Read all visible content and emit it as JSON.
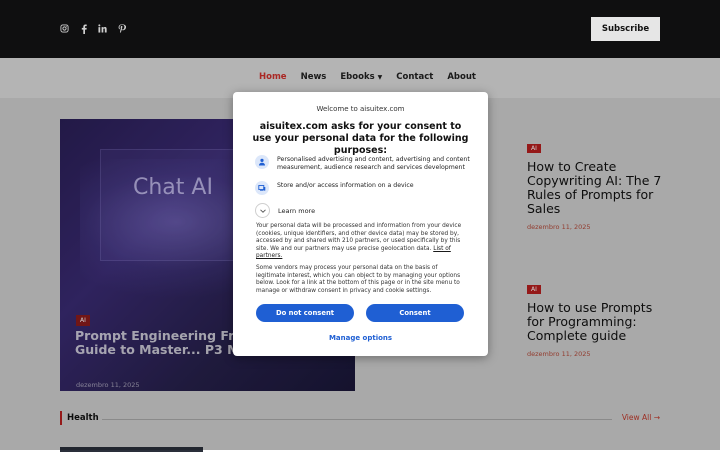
{
  "header": {
    "socials": [
      {
        "icon": "instagram-icon"
      },
      {
        "icon": "facebook-icon"
      },
      {
        "icon": "linkedin-icon"
      },
      {
        "icon": "pinterest-icon"
      }
    ],
    "subscribe_label": "Subscribe"
  },
  "nav": {
    "items": [
      {
        "label": "Home",
        "active": true
      },
      {
        "label": "News"
      },
      {
        "label": "Ebooks"
      },
      {
        "label": "Contact"
      },
      {
        "label": "About"
      }
    ]
  },
  "featured": {
    "image_text": "Chat AI",
    "category": "AI",
    "title": "Prompt Engineering From... Definitive Guide to Master... P3 Method)",
    "date": "dezembro 11, 2025"
  },
  "posts": [
    {
      "category": "AI",
      "title": "How to Create Copywriting AI: The 7 Rules of Prompts for Sales",
      "date": "dezembro 11, 2025"
    },
    {
      "category": "AI",
      "title": "How to use Prompts for Programming: Complete guide",
      "date": "dezembro 11, 2025"
    }
  ],
  "section": {
    "title": "Health",
    "view_all": "View All →"
  },
  "consent": {
    "welcome": "Welcome to aisuitex.com",
    "heading": "aisuitex.com asks for your consent to use your personal data for the following purposes:",
    "purposes": [
      {
        "icon": "person-icon",
        "text": "Personalised advertising and content, advertising and content measurement, audience research and services development"
      },
      {
        "icon": "device-icon",
        "text": "Store and/or access information on a device"
      }
    ],
    "learn_more": "Learn more",
    "paragraph1": "Your personal data will be processed and information from your device (cookies, unique identifiers, and other device data) may be stored by, accessed by and shared with 210 partners, or used specifically by this site. We and our partners may use precise geolocation data.",
    "partners_link": "List of partners.",
    "paragraph2": "Some vendors may process your personal data on the basis of legitimate interest, which you can object to by managing your options below. Look for a link at the bottom of this page or in the site menu to manage or withdraw consent in privacy and cookie settings.",
    "do_not_consent": "Do not consent",
    "consent": "Consent",
    "manage_options": "Manage options"
  }
}
